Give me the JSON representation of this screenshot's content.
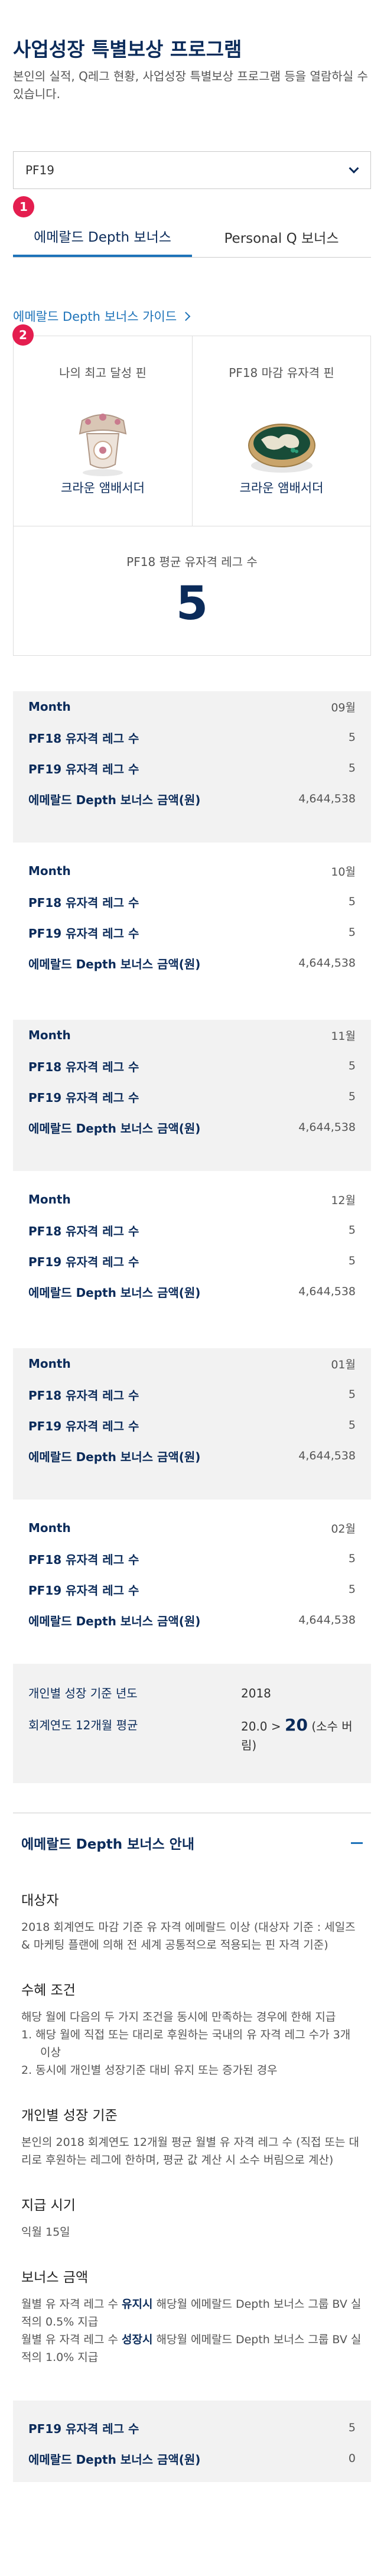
{
  "header": {
    "title": "사업성장 특별보상 프로그램",
    "subtitle": "본인의 실적, Q레그 현황, 사업성장 특별보상 프로그램 등을 열람하실 수 있습니다."
  },
  "period_select": {
    "value": "PF19"
  },
  "badges": {
    "tabs": "1",
    "pins": "2"
  },
  "tabs": [
    {
      "label": "에메랄드 Depth 보너스",
      "active": true
    },
    {
      "label": "Personal Q 보너스",
      "active": false
    }
  ],
  "guide_link": "에메랄드 Depth 보너스 가이드",
  "pins": {
    "best": {
      "label": "나의 최고 달성 핀",
      "name": "크라운 앰배서더"
    },
    "pf18": {
      "label": "PF18 마감 유자격 핀",
      "name": "크라운 앰배서더"
    },
    "avg": {
      "label": "PF18 평균 유자격 레그 수",
      "value": "5"
    }
  },
  "monthly": {
    "labels": {
      "month": "Month",
      "pf18": "PF18 유자격 레그 수",
      "pf19": "PF19 유자격 레그 수",
      "amount": "에메랄드 Depth 보너스 금액(원)"
    },
    "rows": [
      {
        "month": "09월",
        "pf18": "5",
        "pf19": "5",
        "amount": "4,644,538"
      },
      {
        "month": "10월",
        "pf18": "5",
        "pf19": "5",
        "amount": "4,644,538"
      },
      {
        "month": "11월",
        "pf18": "5",
        "pf19": "5",
        "amount": "4,644,538"
      },
      {
        "month": "12월",
        "pf18": "5",
        "pf19": "5",
        "amount": "4,644,538"
      },
      {
        "month": "01월",
        "pf18": "5",
        "pf19": "5",
        "amount": "4,644,538"
      },
      {
        "month": "02월",
        "pf18": "5",
        "pf19": "5",
        "amount": "4,644,538"
      }
    ]
  },
  "basis": {
    "year_label": "개인별 성장 기준 년도",
    "year_value": "2018",
    "avg_label": "회계연도 12개월 평균",
    "avg_prefix": "20.0 > ",
    "avg_value": "20",
    "avg_suffix": " (소수 버림)"
  },
  "guide": {
    "title": "에메랄드 Depth 보너스 안내",
    "target_title": "대상자",
    "target_text": "2018 회계연도 마감 기준 유 자격 에메랄드 이상 (대상자 기준 : 세일즈 & 마케팅 플랜에 의해 전 세계 공통적으로 적용되는 핀 자격 기준)",
    "cond_title": "수혜 조건",
    "cond_text": "해당 월에 다음의 두 가지 조건을 동시에 만족하는 경우에 한해 지급",
    "cond_items": [
      "1. 해당 월에 직접 또는 대리로 후원하는 국내의 유 자격 레그 수가 3개 이상",
      "2. 동시에 개인별 성장기준 대비 유지 또는 증가된 경우"
    ],
    "growth_title": "개인별 성장 기준",
    "growth_text": "본인의 2018 회계연도 12개월 평균 월별 유 자격 레그 수 (직접 또는 대리로 후원하는 레그에 한하며, 평균 값 계산 시 소수 버림으로 계산)",
    "pay_title": "지급 시기",
    "pay_text": "익월 15일",
    "amount_title": "보너스 금액",
    "amount_line1_a": "월별 유 자격 레그 수 ",
    "amount_line1_b": "유지시",
    "amount_line1_c": " 해당월 에메랄드 Depth 보너스 그룹 BV 실적의 0.5% 지급",
    "amount_line2_a": "월별 유 자격 레그 수 ",
    "amount_line2_b": "성장시",
    "amount_line2_c": " 해당월 에메랄드 Depth 보너스 그룹 BV 실적의 1.0% 지급"
  },
  "footer": {
    "pf19_label": "PF19 유자격 레그 수",
    "pf19_value": "5",
    "amount_label": "에메랄드 Depth 보너스 금액(원)",
    "amount_value": "0"
  },
  "colors": {
    "navy": "#0b2b5a",
    "accent": "#1e73b9",
    "badge": "#e41e4f",
    "shade": "#f2f2f2"
  }
}
